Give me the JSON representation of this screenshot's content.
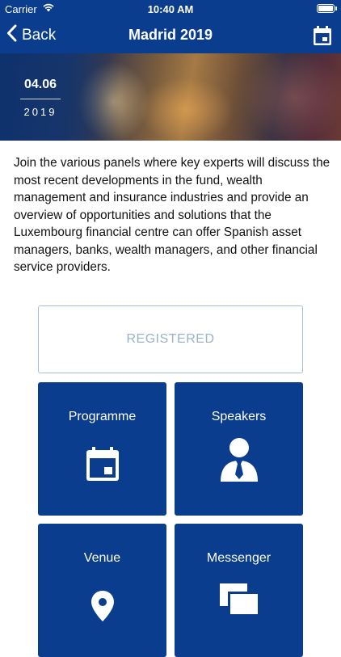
{
  "status_bar": {
    "carrier": "Carrier",
    "time": "10:40 AM"
  },
  "nav": {
    "back_label": "Back",
    "title": "Madrid 2019"
  },
  "hero": {
    "day_month": "04.06",
    "year": "2019"
  },
  "description": "Join the various panels where key experts will discuss the most recent developments in the fund, wealth management and insurance industries and provide an overview of opportunities and solutions that the Luxembourg financial centre can offer Spanish asset managers, banks, wealth managers, and other financial service providers.",
  "registration": {
    "label": "REGISTERED"
  },
  "tiles": [
    {
      "label": "Programme",
      "icon": "calendar-icon"
    },
    {
      "label": "Speakers",
      "icon": "person-icon"
    },
    {
      "label": "Venue",
      "icon": "map-pin-icon"
    },
    {
      "label": "Messenger",
      "icon": "messages-icon"
    }
  ],
  "colors": {
    "brand": "#0b3d8f",
    "registered_border": "#a9bed6",
    "registered_text": "#9ab2cc"
  }
}
